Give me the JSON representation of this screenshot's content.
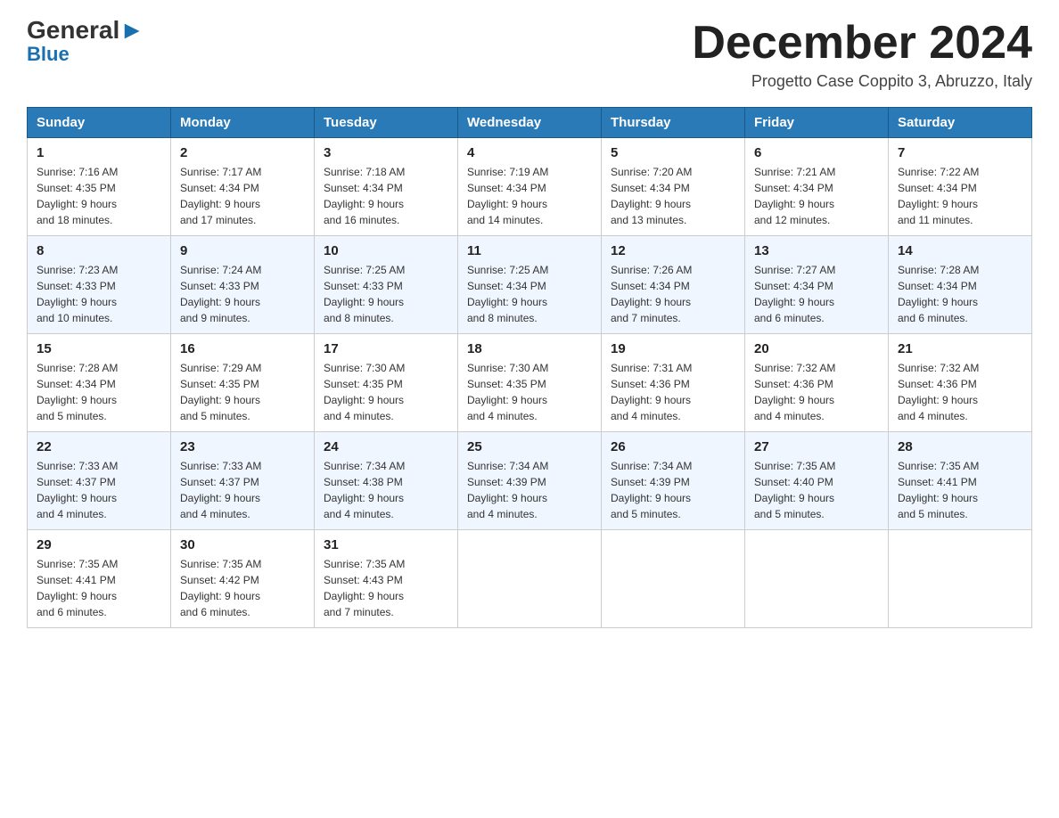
{
  "header": {
    "logo_general": "General",
    "logo_blue": "Blue",
    "month_title": "December 2024",
    "location": "Progetto Case Coppito 3, Abruzzo, Italy"
  },
  "days_of_week": [
    "Sunday",
    "Monday",
    "Tuesday",
    "Wednesday",
    "Thursday",
    "Friday",
    "Saturday"
  ],
  "weeks": [
    [
      {
        "day": "1",
        "sunrise": "7:16 AM",
        "sunset": "4:35 PM",
        "daylight": "9 hours and 18 minutes."
      },
      {
        "day": "2",
        "sunrise": "7:17 AM",
        "sunset": "4:34 PM",
        "daylight": "9 hours and 17 minutes."
      },
      {
        "day": "3",
        "sunrise": "7:18 AM",
        "sunset": "4:34 PM",
        "daylight": "9 hours and 16 minutes."
      },
      {
        "day": "4",
        "sunrise": "7:19 AM",
        "sunset": "4:34 PM",
        "daylight": "9 hours and 14 minutes."
      },
      {
        "day": "5",
        "sunrise": "7:20 AM",
        "sunset": "4:34 PM",
        "daylight": "9 hours and 13 minutes."
      },
      {
        "day": "6",
        "sunrise": "7:21 AM",
        "sunset": "4:34 PM",
        "daylight": "9 hours and 12 minutes."
      },
      {
        "day": "7",
        "sunrise": "7:22 AM",
        "sunset": "4:34 PM",
        "daylight": "9 hours and 11 minutes."
      }
    ],
    [
      {
        "day": "8",
        "sunrise": "7:23 AM",
        "sunset": "4:33 PM",
        "daylight": "9 hours and 10 minutes."
      },
      {
        "day": "9",
        "sunrise": "7:24 AM",
        "sunset": "4:33 PM",
        "daylight": "9 hours and 9 minutes."
      },
      {
        "day": "10",
        "sunrise": "7:25 AM",
        "sunset": "4:33 PM",
        "daylight": "9 hours and 8 minutes."
      },
      {
        "day": "11",
        "sunrise": "7:25 AM",
        "sunset": "4:34 PM",
        "daylight": "9 hours and 8 minutes."
      },
      {
        "day": "12",
        "sunrise": "7:26 AM",
        "sunset": "4:34 PM",
        "daylight": "9 hours and 7 minutes."
      },
      {
        "day": "13",
        "sunrise": "7:27 AM",
        "sunset": "4:34 PM",
        "daylight": "9 hours and 6 minutes."
      },
      {
        "day": "14",
        "sunrise": "7:28 AM",
        "sunset": "4:34 PM",
        "daylight": "9 hours and 6 minutes."
      }
    ],
    [
      {
        "day": "15",
        "sunrise": "7:28 AM",
        "sunset": "4:34 PM",
        "daylight": "9 hours and 5 minutes."
      },
      {
        "day": "16",
        "sunrise": "7:29 AM",
        "sunset": "4:35 PM",
        "daylight": "9 hours and 5 minutes."
      },
      {
        "day": "17",
        "sunrise": "7:30 AM",
        "sunset": "4:35 PM",
        "daylight": "9 hours and 4 minutes."
      },
      {
        "day": "18",
        "sunrise": "7:30 AM",
        "sunset": "4:35 PM",
        "daylight": "9 hours and 4 minutes."
      },
      {
        "day": "19",
        "sunrise": "7:31 AM",
        "sunset": "4:36 PM",
        "daylight": "9 hours and 4 minutes."
      },
      {
        "day": "20",
        "sunrise": "7:32 AM",
        "sunset": "4:36 PM",
        "daylight": "9 hours and 4 minutes."
      },
      {
        "day": "21",
        "sunrise": "7:32 AM",
        "sunset": "4:36 PM",
        "daylight": "9 hours and 4 minutes."
      }
    ],
    [
      {
        "day": "22",
        "sunrise": "7:33 AM",
        "sunset": "4:37 PM",
        "daylight": "9 hours and 4 minutes."
      },
      {
        "day": "23",
        "sunrise": "7:33 AM",
        "sunset": "4:37 PM",
        "daylight": "9 hours and 4 minutes."
      },
      {
        "day": "24",
        "sunrise": "7:34 AM",
        "sunset": "4:38 PM",
        "daylight": "9 hours and 4 minutes."
      },
      {
        "day": "25",
        "sunrise": "7:34 AM",
        "sunset": "4:39 PM",
        "daylight": "9 hours and 4 minutes."
      },
      {
        "day": "26",
        "sunrise": "7:34 AM",
        "sunset": "4:39 PM",
        "daylight": "9 hours and 5 minutes."
      },
      {
        "day": "27",
        "sunrise": "7:35 AM",
        "sunset": "4:40 PM",
        "daylight": "9 hours and 5 minutes."
      },
      {
        "day": "28",
        "sunrise": "7:35 AM",
        "sunset": "4:41 PM",
        "daylight": "9 hours and 5 minutes."
      }
    ],
    [
      {
        "day": "29",
        "sunrise": "7:35 AM",
        "sunset": "4:41 PM",
        "daylight": "9 hours and 6 minutes."
      },
      {
        "day": "30",
        "sunrise": "7:35 AM",
        "sunset": "4:42 PM",
        "daylight": "9 hours and 6 minutes."
      },
      {
        "day": "31",
        "sunrise": "7:35 AM",
        "sunset": "4:43 PM",
        "daylight": "9 hours and 7 minutes."
      },
      null,
      null,
      null,
      null
    ]
  ],
  "labels": {
    "sunrise_prefix": "Sunrise: ",
    "sunset_prefix": "Sunset: ",
    "daylight_prefix": "Daylight: "
  }
}
